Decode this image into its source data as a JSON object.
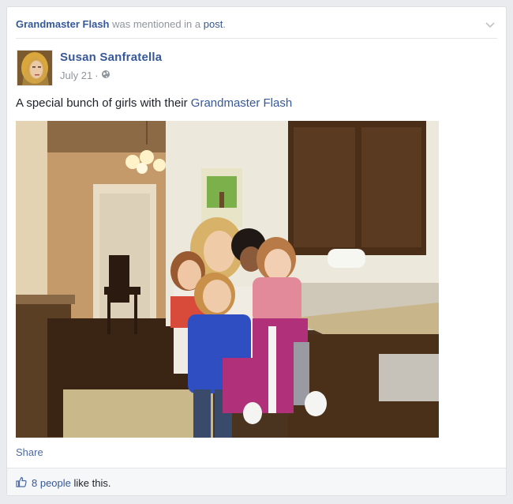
{
  "notification": {
    "subject": "Grandmaster Flash",
    "middle": " was mentioned in a ",
    "object": "post",
    "end": "."
  },
  "post": {
    "author": "Susan Sanfratella",
    "date": "July 21",
    "separator": "·",
    "caption_prefix": "A special bunch of girls with their ",
    "caption_link": "Grandmaster Flash",
    "share_label": "Share"
  },
  "likes": {
    "count_text": "8 people",
    "suffix": " like this."
  },
  "icons": {
    "chevron": "chevron-down-icon",
    "audience": "globe-icon",
    "like": "thumbs-up-icon"
  },
  "colors": {
    "link": "#365899",
    "meta": "#90949c",
    "background": "#e9ebee"
  }
}
